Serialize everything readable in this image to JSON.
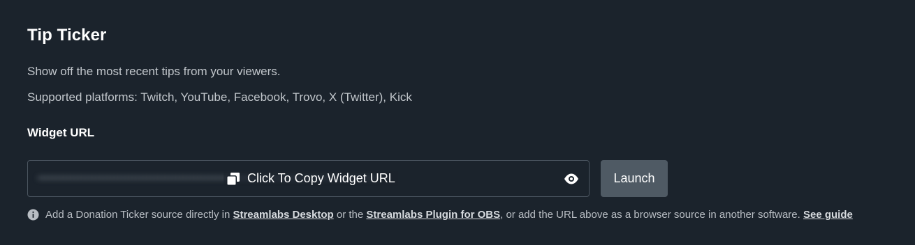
{
  "widget": {
    "title": "Tip Ticker",
    "description": "Show off the most recent tips from your viewers.",
    "platforms": "Supported platforms: Twitch, YouTube, Facebook, Trovo, X (Twitter), Kick"
  },
  "url_section": {
    "label": "Widget URL",
    "copy_label": "Click To Copy Widget URL",
    "launch_label": "Launch"
  },
  "note": {
    "text_1": "Add a Donation Ticker source directly in ",
    "link_1": "Streamlabs Desktop",
    "text_2": " or the ",
    "link_2": "Streamlabs Plugin for OBS",
    "text_3": ", or add the URL above as a browser source in another software. ",
    "link_3": "See guide"
  },
  "icons": {
    "copy": "copy-icon",
    "eye": "eye-icon",
    "info": "info-icon"
  },
  "colors": {
    "background": "#1b232c",
    "launch_button": "#4f5a64",
    "border": "#4b5560"
  }
}
